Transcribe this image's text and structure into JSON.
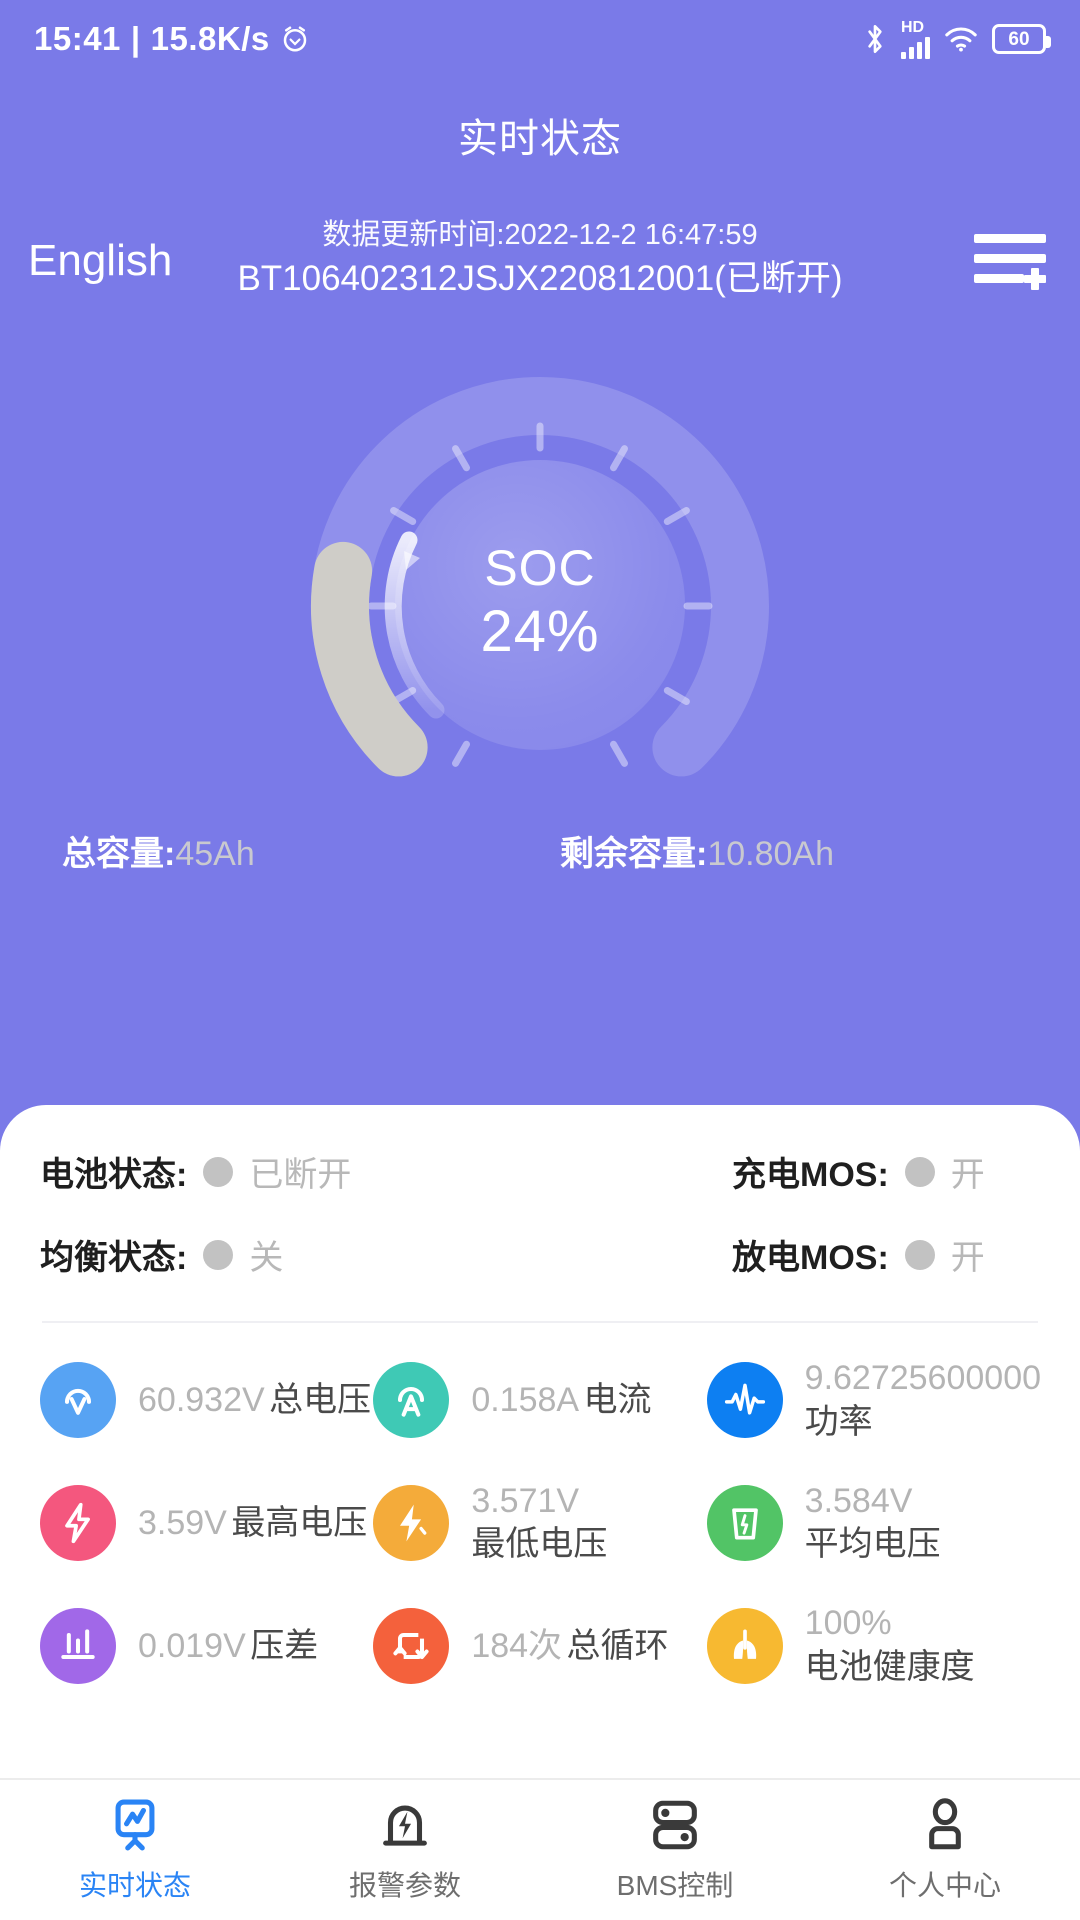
{
  "statusbar": {
    "time": "15:41",
    "separator": "|",
    "netspeed": "15.8K/s",
    "hd_label": "HD",
    "battery_level": "60"
  },
  "header": {
    "title": "实时状态",
    "language_toggle": "English",
    "update_time": "数据更新时间:2022-12-2 16:47:59",
    "device_id": "BT106402312JSJX220812001(已断开)"
  },
  "gauge": {
    "soc_label": "SOC",
    "soc_value": "24%",
    "percent": 24
  },
  "capacity": {
    "total_key": "总容量:",
    "total_value": "45Ah",
    "remaining_key": "剩余容量:",
    "remaining_value": "10.80Ah"
  },
  "status": [
    {
      "key": "电池状态:",
      "value": "已断开"
    },
    {
      "key": "充电MOS:",
      "value": "开"
    },
    {
      "key": "均衡状态:",
      "value": "关"
    },
    {
      "key": "放电MOS:",
      "value": "开"
    }
  ],
  "metrics": [
    {
      "value": "60.932V",
      "label": "总电压",
      "icon": "voltmeter-icon",
      "color": "#57a3f3"
    },
    {
      "value": "0.158A",
      "label": "电流",
      "icon": "ammeter-icon",
      "color": "#3fc9b5"
    },
    {
      "value": "9.62725600000",
      "label": "功率",
      "icon": "waveform-icon",
      "color": "#0d7ff2"
    },
    {
      "value": "3.59V",
      "label": "最高电压",
      "icon": "bolt-high-icon",
      "color": "#f4577e"
    },
    {
      "value": "3.571V",
      "label": "最低电压",
      "icon": "bolt-low-icon",
      "color": "#f4ab3a"
    },
    {
      "value": "3.584V",
      "label": "平均电压",
      "icon": "battery-average-icon",
      "color": "#52c466"
    },
    {
      "value": "0.019V",
      "label": "压差",
      "icon": "levels-icon",
      "color": "#a168e8"
    },
    {
      "value": "184次",
      "label": "总循环",
      "icon": "cycle-icon",
      "color": "#f4613c"
    },
    {
      "value": "100%",
      "label": "电池健康度",
      "icon": "health-lungs-icon",
      "color": "#f7b931"
    }
  ],
  "tabs": [
    {
      "label": "实时状态",
      "icon": "monitor-icon",
      "active": true
    },
    {
      "label": "报警参数",
      "icon": "alarm-bolt-icon",
      "active": false
    },
    {
      "label": "BMS控制",
      "icon": "battery-control-icon",
      "active": false
    },
    {
      "label": "个人中心",
      "icon": "person-icon",
      "active": false
    }
  ],
  "colors": {
    "background": "#7a7ae8",
    "card": "#ffffff",
    "accent": "#2a84f5",
    "muted_text": "#b4b4b4"
  }
}
